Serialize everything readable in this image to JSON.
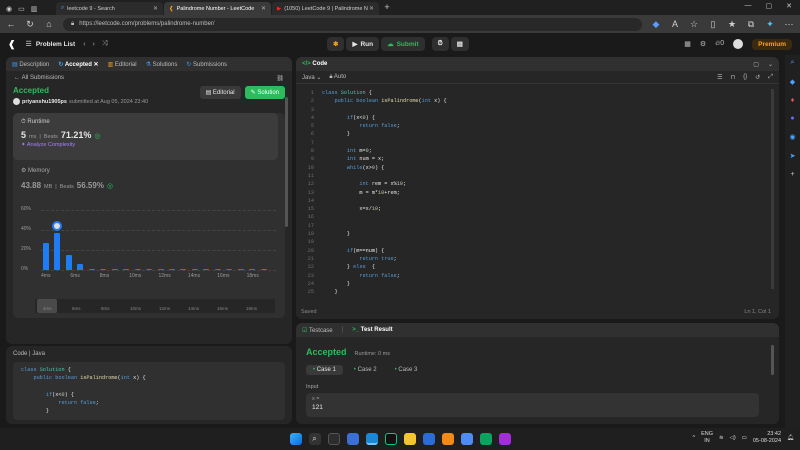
{
  "browser": {
    "tabs": [
      {
        "title": "leetcode 9 - Search"
      },
      {
        "title": "Palindrome Number - LeetCode"
      },
      {
        "title": "(1050) LeetCode 9 | Palindrome N"
      }
    ],
    "url": "https://leetcode.com/problems/palindrome-number/"
  },
  "lc": {
    "problem_list": "Problem List",
    "run": "Run",
    "submit": "Submit",
    "premium": "Premium",
    "streak": "0"
  },
  "left": {
    "tabs": [
      "Description",
      "Accepted",
      "Editorial",
      "Solutions",
      "Submissions"
    ],
    "back": "All Submissions",
    "status": "Accepted",
    "user": "priyanshu1905ps",
    "submitted": "submitted at Aug 05, 2024 23:40",
    "editorial_btn": "Editorial",
    "solution_btn": "Solution",
    "runtime_label": "Runtime",
    "runtime_val": "5",
    "runtime_unit": "ms",
    "beats_label": "Beats",
    "runtime_beats": "71.21%",
    "analyze": "Analyze Complexity",
    "memory_label": "Memory",
    "memory_val": "43.88",
    "memory_unit": "MB",
    "memory_beats": "56.59%",
    "code_lang": "Code | Java"
  },
  "chart_data": {
    "type": "bar",
    "y_ticks": [
      "60%",
      "40%",
      "20%",
      "0%"
    ],
    "ylim": [
      0,
      60
    ],
    "x_labels": [
      "4ms",
      "6ms",
      "8ms",
      "10ms",
      "12ms",
      "14ms",
      "16ms",
      "18ms"
    ],
    "values": [
      27,
      37,
      15,
      6,
      1,
      1,
      1,
      1,
      1,
      1,
      1,
      1,
      1,
      1,
      1,
      1,
      1,
      1,
      1,
      1
    ],
    "highlight_index": 1,
    "mini_labels": [
      "4ms",
      "6ms",
      "8ms",
      "10ms",
      "12ms",
      "14ms",
      "16ms",
      "18ms"
    ]
  },
  "editor": {
    "title": "Code",
    "lang": "Java",
    "auto": "Auto",
    "saved": "Saved",
    "cursor": "Ln 1, Col 1"
  },
  "result": {
    "tab1": "Testcase",
    "tab2": "Test Result",
    "status": "Accepted",
    "runtime": "Runtime: 0 ms",
    "cases": [
      "Case 1",
      "Case 2",
      "Case 3"
    ],
    "input_label": "Input",
    "var": "x =",
    "value": "121"
  },
  "snippet": [
    "class Solution {",
    "    public boolean isPalindrome(int x) {",
    "",
    "        if(x<0) {",
    "            return false;",
    "        }"
  ],
  "code_lines": [
    "class Solution {",
    "    public boolean isPalindrome(int x) {",
    "",
    "        if(x<0) {",
    "            return false;",
    "        }",
    "",
    "        int m=0;",
    "        int num = x;",
    "        while(x>0) {",
    "",
    "            int rem = x%10;",
    "            m = m*10+rem;",
    "",
    "            x=x/10;",
    "",
    "",
    "        }",
    "",
    "        if(m==num) {",
    "            return true;",
    "        } else  {",
    "            return false;",
    "        }",
    "    }"
  ],
  "tray": {
    "lang1": "ENG",
    "lang2": "IN",
    "time": "23:42",
    "date": "05-08-2024"
  }
}
